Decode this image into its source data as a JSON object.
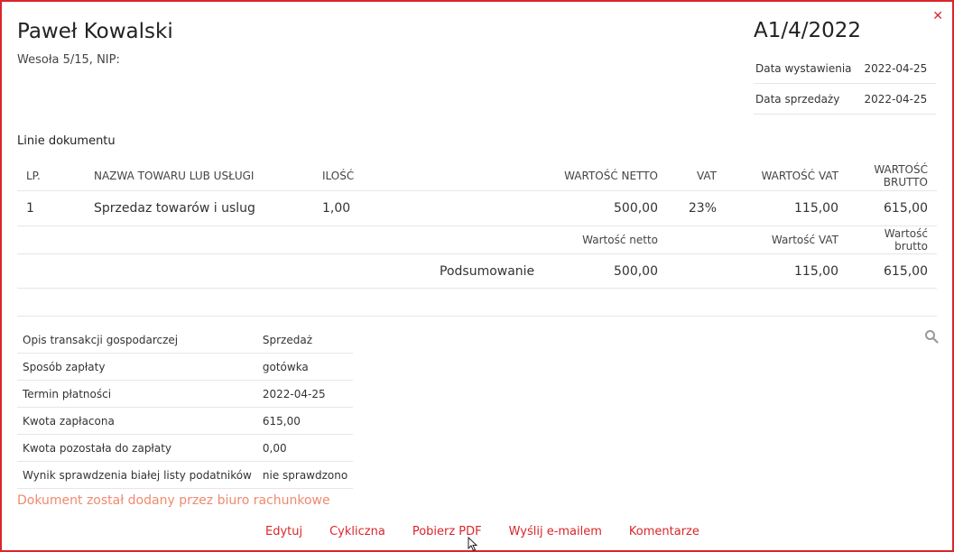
{
  "seller": {
    "name": "Paweł Kowalski",
    "address": "Wesoła 5/15, NIP:"
  },
  "document": {
    "number": "A1/4/2022"
  },
  "dates": [
    {
      "label": "Data wystawienia",
      "value": "2022-04-25"
    },
    {
      "label": "Data sprzedaży",
      "value": "2022-04-25"
    }
  ],
  "lines_section": {
    "title": "Linie dokumentu"
  },
  "table": {
    "headers": [
      "LP.",
      "NAZWA TOWARU LUB USŁUGI",
      "ILOŚĆ",
      "WARTOŚĆ NETTO",
      "VAT",
      "WARTOŚĆ VAT",
      "WARTOŚĆ BRUTTO"
    ],
    "rows": [
      [
        "1",
        "Sprzedaz towarów i uslug",
        "1,00",
        "500,00",
        "23%",
        "115,00",
        "615,00"
      ]
    ]
  },
  "summary": {
    "netto_label": "Wartość netto",
    "vat_label": "Wartość VAT",
    "brutto_label": "Wartość brutto",
    "label": "Podsumowanie",
    "netto": "500,00",
    "vat": "115,00",
    "brutto": "615,00"
  },
  "info": [
    {
      "label": "Opis transakcji gospodarczej",
      "value": "Sprzedaż"
    },
    {
      "label": "Sposób zapłaty",
      "value": "gotówka"
    },
    {
      "label": "Termin płatności",
      "value": "2022-04-25"
    },
    {
      "label": "Kwota zapłacona",
      "value": "615,00"
    },
    {
      "label": "Kwota pozostała do zapłaty",
      "value": "0,00"
    },
    {
      "label": "Wynik sprawdzenia białej listy podatników",
      "value": "nie sprawdzono"
    }
  ],
  "note": "Dokument został dodany przez biuro rachunkowe",
  "actions": {
    "edit": "Edytuj",
    "recurring": "Cykliczna",
    "download_pdf": "Pobierz PDF",
    "send_email": "Wyślij e-mailem",
    "comments": "Komentarze"
  },
  "colors": {
    "accent": "#d9262b",
    "note": "#ee8a6e"
  },
  "icons": {
    "close": "close-icon",
    "search": "search-icon"
  }
}
